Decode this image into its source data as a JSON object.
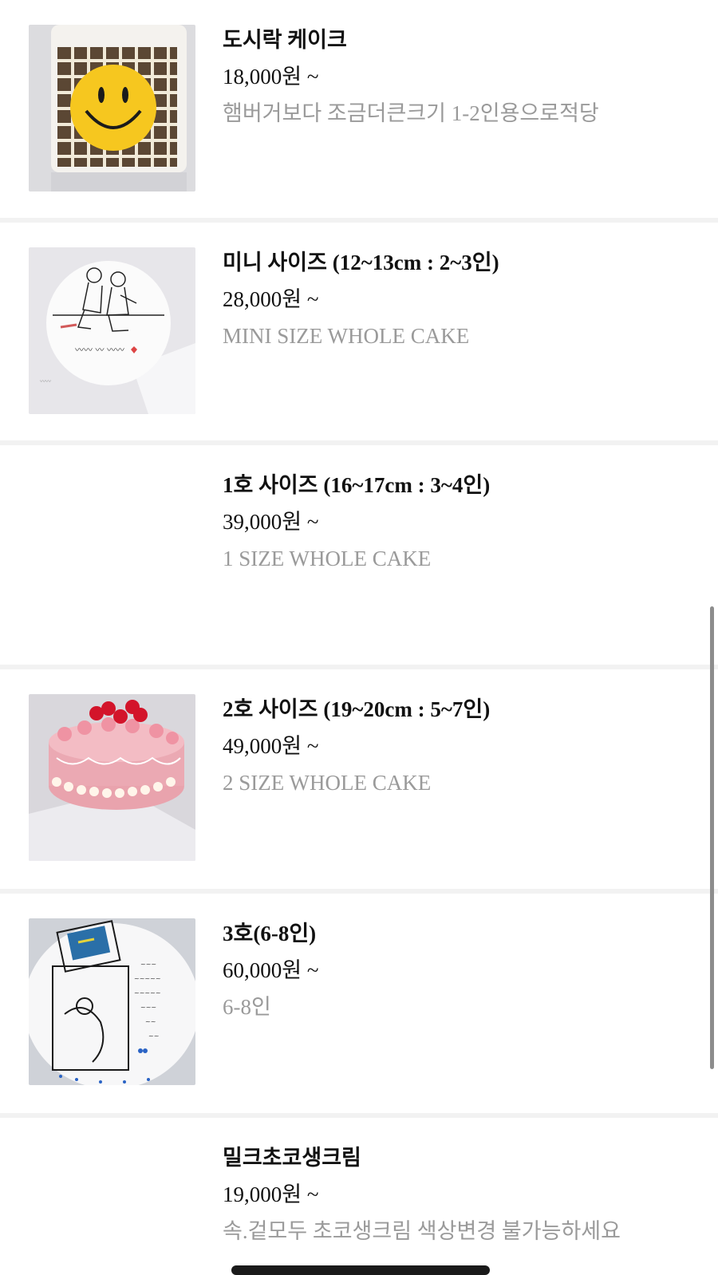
{
  "items": [
    {
      "title": "도시락 케이크",
      "price": "18,000원 ~",
      "description": "햄버거보다 조금더큰크기 1-2인용으로적당",
      "image": "smiley-lunchbox-cake"
    },
    {
      "title": "미니 사이즈 (12~13cm : 2~3인)",
      "price": "28,000원 ~",
      "description": "MINI SIZE WHOLE CAKE",
      "image": "couple-drawing-cake"
    },
    {
      "title": "1호 사이즈 (16~17cm : 3~4인)",
      "price": "39,000원 ~",
      "description": "1 SIZE WHOLE CAKE",
      "image": ""
    },
    {
      "title": "2호 사이즈 (19~20cm : 5~7인)",
      "price": "49,000원 ~",
      "description": "2 SIZE WHOLE CAKE",
      "image": "pink-cherry-cake"
    },
    {
      "title": "3호(6-8인)",
      "price": "60,000원 ~",
      "description": "6-8인",
      "image": "comic-drawing-cake"
    },
    {
      "title": "밀크초코생크림",
      "price": "19,000원 ~",
      "description": "속.겉모두 초코생크림 색상변경 불가능하세요",
      "image": ""
    }
  ],
  "colors": {
    "title": "#111111",
    "description": "#9a9a9a",
    "divider": "#f2f2f2"
  }
}
